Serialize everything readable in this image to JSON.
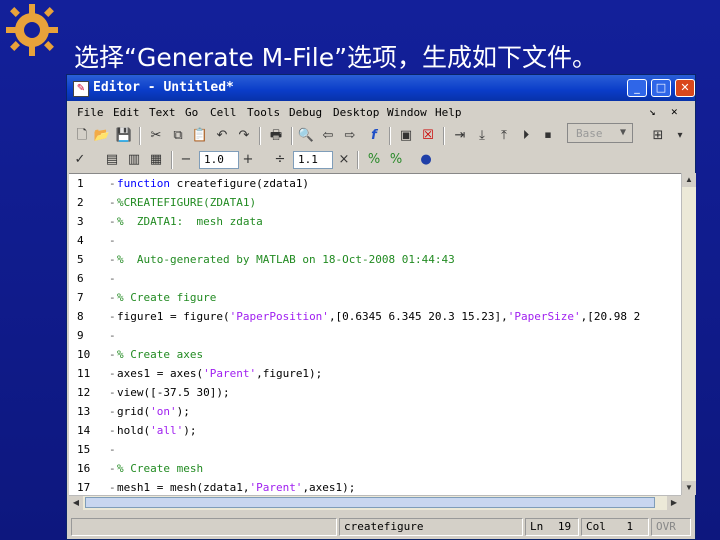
{
  "slide": {
    "title": "选择“Generate M-File”选项，生成如下文件。"
  },
  "window": {
    "title": "Editor - Untitled*",
    "controls": {
      "minimize": "_",
      "maximize": "□",
      "close": "✕"
    }
  },
  "menu": [
    "File",
    "Edit",
    "Text",
    "Go",
    "Cell",
    "Tools",
    "Debug",
    "Desktop",
    "Window",
    "Help"
  ],
  "menu_extras": {
    "undock": "↘",
    "close_doc": "✕"
  },
  "toolbar": {
    "base_label": "Base",
    "cell_increment_value": "1.0",
    "cell_divide_value": "1.1"
  },
  "editor": {
    "lines": [
      {
        "num": "1",
        "kind": "kw",
        "text": "function createfigure(zdata1)"
      },
      {
        "num": "2",
        "kind": "cm",
        "text": "%CREATEFIGURE(ZDATA1)"
      },
      {
        "num": "3",
        "kind": "cm",
        "text": "%  ZDATA1:  mesh zdata"
      },
      {
        "num": "4",
        "kind": "plain",
        "text": ""
      },
      {
        "num": "5",
        "kind": "cm",
        "text": "%  Auto-generated by MATLAB on 18-Oct-2008 01:44:43"
      },
      {
        "num": "6",
        "kind": "plain",
        "text": ""
      },
      {
        "num": "7",
        "kind": "cm",
        "text": "% Create figure"
      },
      {
        "num": "8",
        "kind": "plain",
        "text": "figure1 = figure('PaperPosition',[0.6345 6.345 20.3 15.23],'PaperSize',[20.98 2"
      },
      {
        "num": "9",
        "kind": "plain",
        "text": ""
      },
      {
        "num": "10",
        "kind": "cm",
        "text": "% Create axes"
      },
      {
        "num": "11",
        "kind": "plain",
        "text": "axes1 = axes('Parent',figure1);"
      },
      {
        "num": "12",
        "kind": "plain",
        "text": "view([-37.5 30]);"
      },
      {
        "num": "13",
        "kind": "plain",
        "text": "grid('on');"
      },
      {
        "num": "14",
        "kind": "plain",
        "text": "hold('all');"
      },
      {
        "num": "15",
        "kind": "plain",
        "text": ""
      },
      {
        "num": "16",
        "kind": "cm",
        "text": "% Create mesh"
      },
      {
        "num": "17",
        "kind": "plain",
        "text": "mesh1 = mesh(zdata1,'Parent',axes1);"
      }
    ]
  },
  "status": {
    "function_name": "createfigure",
    "ln_label": "Ln",
    "ln_value": "19",
    "col_label": "Col",
    "col_value": "1",
    "mode": "OVR"
  },
  "colors": {
    "slide_bg": "#13209a",
    "keyword": "#0000ff",
    "comment": "#228b22",
    "string": "#a020f0",
    "titlebar": "#0a3cc8"
  }
}
